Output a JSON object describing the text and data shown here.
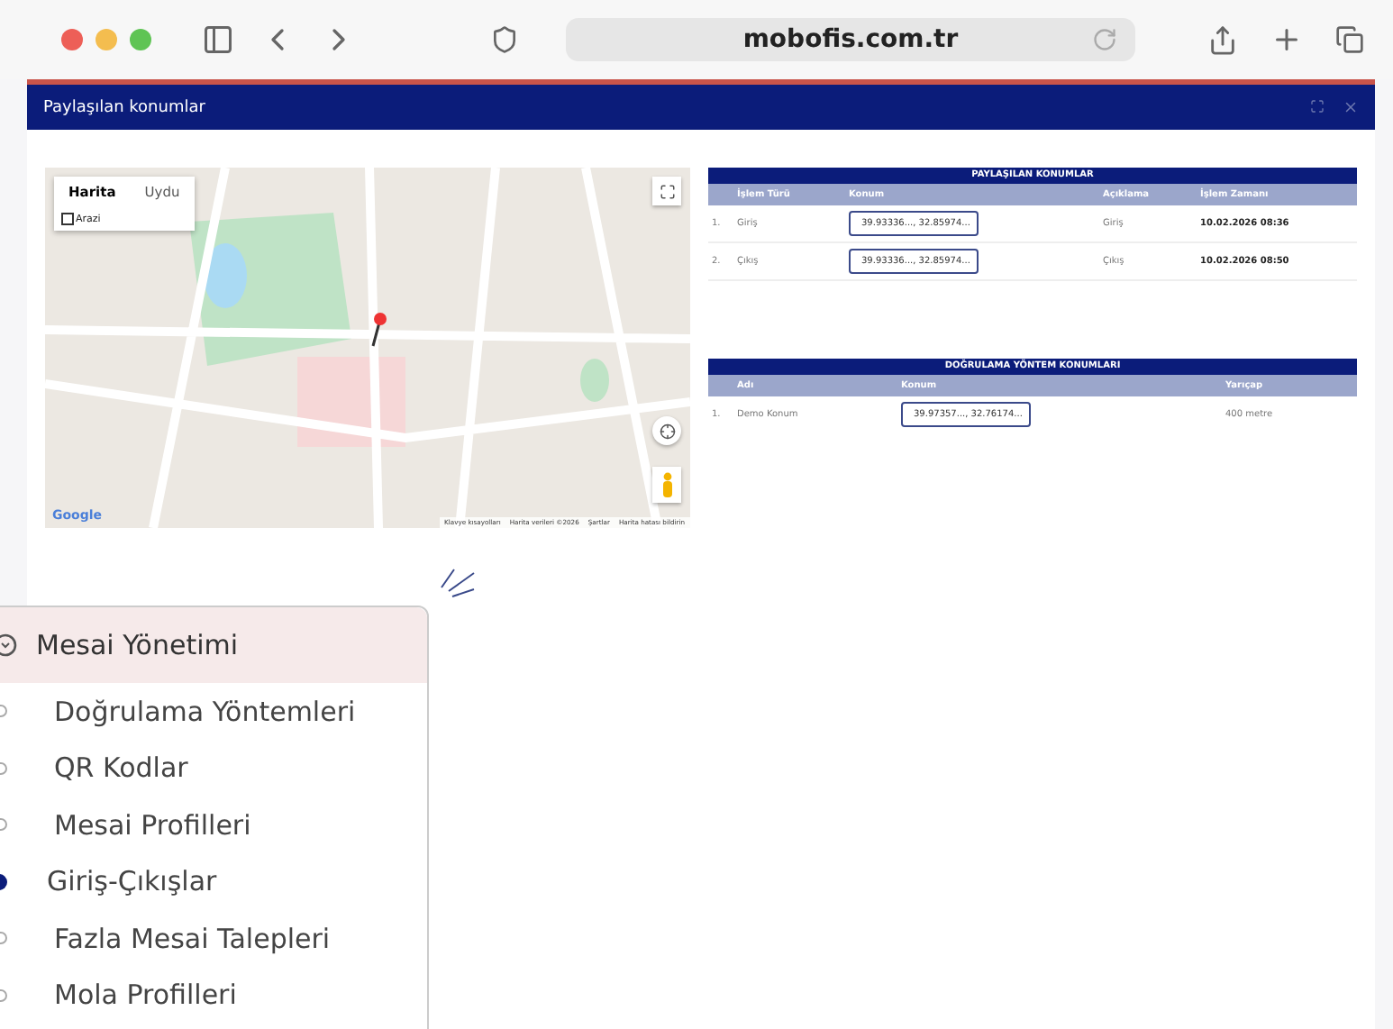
{
  "browser": {
    "url": "mobofis.com.tr"
  },
  "dialog": {
    "title": "Paylaşılan konumlar"
  },
  "map": {
    "map_types": [
      {
        "label": "Harita",
        "selected": true
      },
      {
        "label": "Uydu",
        "selected": false
      }
    ],
    "terrain": {
      "label": "Arazi",
      "checked": false
    },
    "logo": "Google",
    "attribution": [
      "Klavye kısayolları",
      "Harita verileri ©2026",
      "Şartlar",
      "Harita hatası bildirin"
    ]
  },
  "shared_table": {
    "title": "PAYLAŞILAN KONUMLAR",
    "columns": [
      "İşlem Türü",
      "Konum",
      "Açıklama",
      "İşlem Zamanı"
    ],
    "rows": [
      {
        "index": "1.",
        "type": "Giriş",
        "location": "39.93336..., 32.85974...",
        "description": "Giriş",
        "time": "10.02.2026 08:36"
      },
      {
        "index": "2.",
        "type": "Çıkış",
        "location": "39.93336..., 32.85974...",
        "description": "Çıkış",
        "time": "10.02.2026 08:50"
      }
    ]
  },
  "method_table": {
    "title": "DOĞRULAMA YÖNTEM KONUMLARI",
    "columns": [
      "Adı",
      "Konum",
      "Yarıçap"
    ],
    "rows": [
      {
        "index": "1.",
        "name": "Demo Konum",
        "location": "39.97357..., 32.76174...",
        "radius": "400 metre"
      }
    ]
  },
  "sidebar": {
    "header": {
      "label": "Mesai Yönetimi",
      "expanded": true
    },
    "items": [
      {
        "label": "Doğrulama Yöntemleri",
        "selected": false
      },
      {
        "label": "QR Kodlar",
        "selected": false
      },
      {
        "label": "Mesai Profilleri",
        "selected": false
      },
      {
        "label": "Giriş-Çıkışlar",
        "selected": true
      },
      {
        "label": "Fazla Mesai Talepleri",
        "selected": false
      },
      {
        "label": "Mola Profilleri",
        "selected": false
      }
    ]
  }
}
